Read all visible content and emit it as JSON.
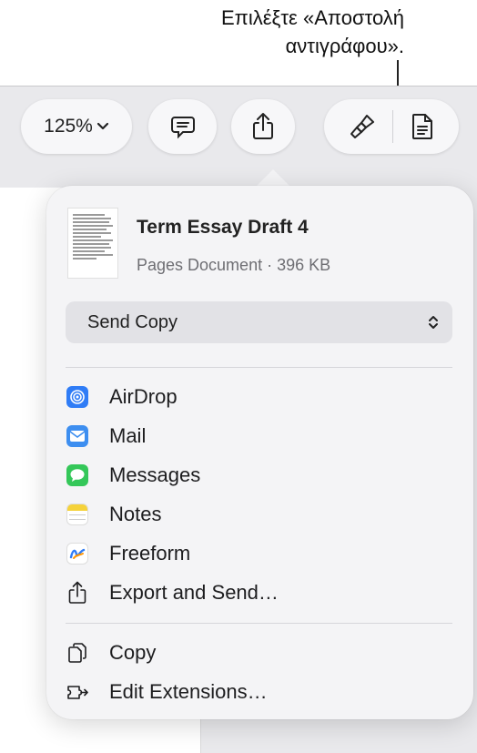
{
  "callout": {
    "line1": "Επιλέξτε «Αποστολή",
    "line2": "αντιγράφου»."
  },
  "toolbar": {
    "zoom_label": "125%",
    "zoom_chevron": "chevron-down-icon"
  },
  "share_popover": {
    "doc_title": "Term Essay Draft 4",
    "doc_meta": "Pages Document · 396 KB",
    "send_mode": "Send Copy",
    "items": [
      {
        "label": "AirDrop",
        "icon": "airdrop-icon",
        "color": "#2f7cf6"
      },
      {
        "label": "Mail",
        "icon": "mail-icon",
        "color": "#3d8ef0"
      },
      {
        "label": "Messages",
        "icon": "messages-icon",
        "color": "#34c759"
      },
      {
        "label": "Notes",
        "icon": "notes-icon",
        "color": "#f5d23a"
      },
      {
        "label": "Freeform",
        "icon": "freeform-icon",
        "color": "#ffffff"
      },
      {
        "label": "Export and Send…",
        "icon": "export-icon",
        "color": "#1d1d1f"
      }
    ],
    "actions": [
      {
        "label": "Copy",
        "icon": "copy-icon"
      },
      {
        "label": "Edit Extensions…",
        "icon": "extensions-icon"
      }
    ]
  }
}
